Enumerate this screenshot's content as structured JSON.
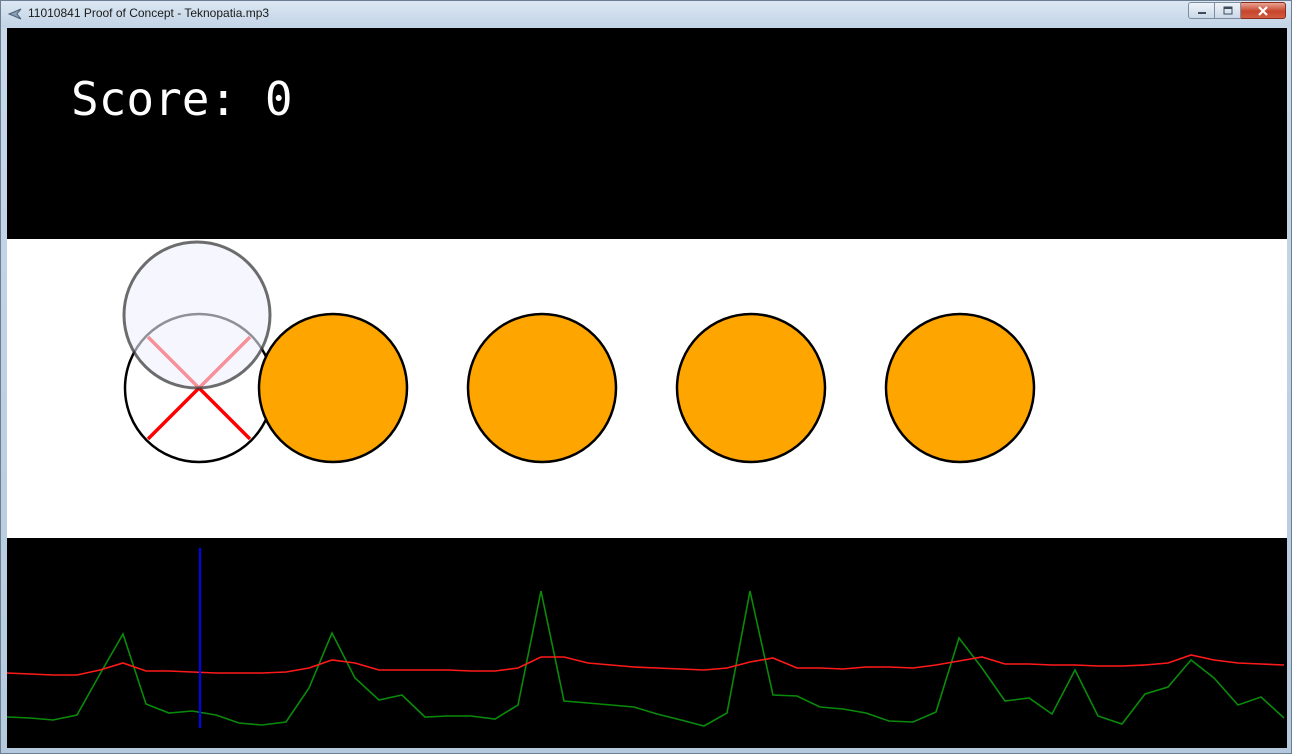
{
  "window": {
    "title": "11010841 Proof of Concept - Teknopatia.mp3",
    "controls": [
      "minimize-icon",
      "maximize-icon",
      "close-icon"
    ]
  },
  "game": {
    "score_text": "Score: 0",
    "hit_target": {
      "marker": "x-icon",
      "cursor": "circle"
    },
    "notes": [
      {
        "color": "#ffa500"
      },
      {
        "color": "#ffa500"
      },
      {
        "color": "#ffa500"
      },
      {
        "color": "#ffa500"
      }
    ]
  },
  "visualizer": {
    "colors": {
      "energy": "#008000",
      "average": "#ff0000",
      "playhead": "#0000ff",
      "note": "#ffa500"
    }
  }
}
